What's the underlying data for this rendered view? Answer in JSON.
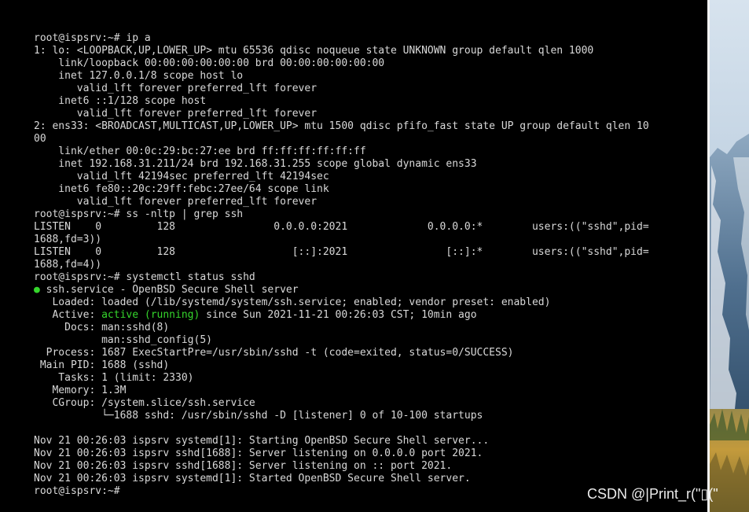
{
  "terminal": {
    "lines": [
      "root@ispsrv:~# ip a",
      "1: lo: <LOOPBACK,UP,LOWER_UP> mtu 65536 qdisc noqueue state UNKNOWN group default qlen 1000",
      "    link/loopback 00:00:00:00:00:00 brd 00:00:00:00:00:00",
      "    inet 127.0.0.1/8 scope host lo",
      "       valid_lft forever preferred_lft forever",
      "    inet6 ::1/128 scope host",
      "       valid_lft forever preferred_lft forever",
      "2: ens33: <BROADCAST,MULTICAST,UP,LOWER_UP> mtu 1500 qdisc pfifo_fast state UP group default qlen 10",
      "00",
      "    link/ether 00:0c:29:bc:27:ee brd ff:ff:ff:ff:ff:ff",
      "    inet 192.168.31.211/24 brd 192.168.31.255 scope global dynamic ens33",
      "       valid_lft 42194sec preferred_lft 42194sec",
      "    inet6 fe80::20c:29ff:febc:27ee/64 scope link",
      "       valid_lft forever preferred_lft forever",
      "root@ispsrv:~# ss -nltp | grep ssh",
      "LISTEN    0         128                0.0.0.0:2021             0.0.0.0:*        users:((\"sshd\",pid=",
      "1688,fd=3))",
      "LISTEN    0         128                   [::]:2021                [::]:*        users:((\"sshd\",pid=",
      "1688,fd=4))",
      "root@ispsrv:~# systemctl status sshd",
      "",
      "   Loaded: loaded (/lib/systemd/system/ssh.service; enabled; vendor preset: enabled)",
      "",
      "     Docs: man:sshd(8)",
      "           man:sshd_config(5)",
      "  Process: 1687 ExecStartPre=/usr/sbin/sshd -t (code=exited, status=0/SUCCESS)",
      " Main PID: 1688 (sshd)",
      "    Tasks: 1 (limit: 2330)",
      "   Memory: 1.3M",
      "   CGroup: /system.slice/ssh.service",
      "           └─1688 sshd: /usr/sbin/sshd -D [listener] 0 of 10-100 startups",
      "",
      "Nov 21 00:26:03 ispsrv systemd[1]: Starting OpenBSD Secure Shell server...",
      "Nov 21 00:26:03 ispsrv sshd[1688]: Server listening on 0.0.0.0 port 2021.",
      "Nov 21 00:26:03 ispsrv sshd[1688]: Server listening on :: port 2021.",
      "Nov 21 00:26:03 ispsrv systemd[1]: Started OpenBSD Secure Shell server.",
      "root@ispsrv:~#"
    ],
    "service_line": {
      "bullet": "●",
      "text": " ssh.service - OpenBSD Secure Shell server"
    },
    "active_line": {
      "prefix": "   Active: ",
      "status": "active (running)",
      "suffix": " since Sun 2021-11-21 00:26:03 CST; 10min ago"
    }
  },
  "watermark": {
    "text": "CSDN @|Print_r(\"▯(\""
  },
  "colors": {
    "background": "#000000",
    "foreground": "#d9d9d9",
    "active_green": "#35d62c",
    "divider": "#f2f2f2"
  }
}
